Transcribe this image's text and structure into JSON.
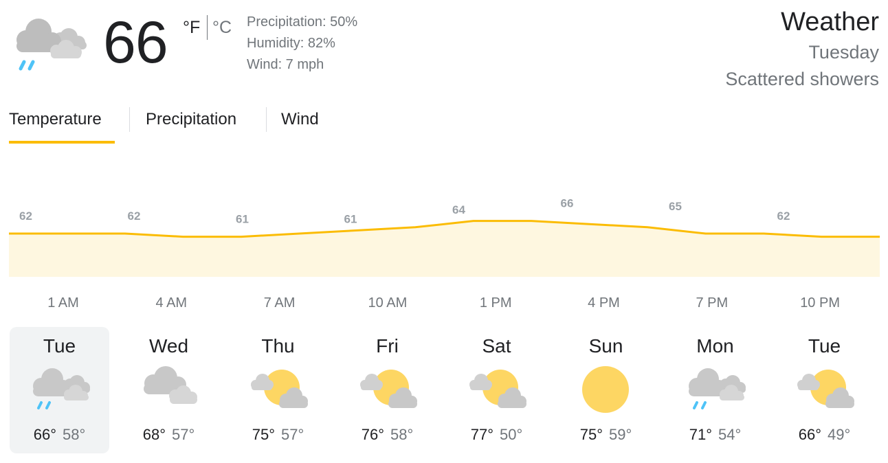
{
  "current": {
    "icon": "rain-cloud-icon",
    "temperature": "66",
    "unit_f": "°F",
    "unit_c": "°C",
    "precipitation": "Precipitation: 50%",
    "humidity": "Humidity: 82%",
    "wind": "Wind: 7 mph"
  },
  "header": {
    "title": "Weather",
    "day": "Tuesday",
    "condition": "Scattered showers"
  },
  "tabs": [
    {
      "label": "Temperature",
      "selected": true
    },
    {
      "label": "Precipitation",
      "selected": false
    },
    {
      "label": "Wind",
      "selected": false
    }
  ],
  "colors": {
    "accent": "#fbbc04",
    "chart_fill": "#fef7e0",
    "text_primary": "#202124",
    "text_secondary": "#70757a",
    "selected_card": "#f1f3f4",
    "rain": "#4fc3f7",
    "cloud": "#c8c8c8",
    "sun": "#fdd663"
  },
  "chart_data": {
    "type": "area",
    "title": "",
    "xlabel": "",
    "ylabel": "",
    "x_ticks": [
      "1 AM",
      "4 AM",
      "7 AM",
      "10 AM",
      "1 PM",
      "4 PM",
      "7 PM",
      "10 PM"
    ],
    "labeled_values": [
      62,
      62,
      61,
      61,
      64,
      66,
      65,
      62
    ],
    "series": [
      {
        "values": [
          62,
          62,
          62,
          61,
          61,
          62,
          63,
          64,
          66,
          66,
          65,
          64,
          62,
          62,
          61,
          61
        ]
      }
    ],
    "grid": false,
    "legend": "none"
  },
  "forecast": [
    {
      "day": "Tue",
      "icon": "rain-cloud-icon",
      "high": "66°",
      "low": "58°",
      "selected": true
    },
    {
      "day": "Wed",
      "icon": "cloud-icon",
      "high": "68°",
      "low": "57°",
      "selected": false
    },
    {
      "day": "Thu",
      "icon": "partly-cloudy-icon",
      "high": "75°",
      "low": "57°",
      "selected": false
    },
    {
      "day": "Fri",
      "icon": "partly-cloudy-icon",
      "high": "76°",
      "low": "58°",
      "selected": false
    },
    {
      "day": "Sat",
      "icon": "partly-cloudy-icon",
      "high": "77°",
      "low": "50°",
      "selected": false
    },
    {
      "day": "Sun",
      "icon": "sun-icon",
      "high": "75°",
      "low": "59°",
      "selected": false
    },
    {
      "day": "Mon",
      "icon": "rain-cloud-icon",
      "high": "71°",
      "low": "54°",
      "selected": false
    },
    {
      "day": "Tue",
      "icon": "partly-cloudy-icon",
      "high": "66°",
      "low": "49°",
      "selected": false
    }
  ]
}
